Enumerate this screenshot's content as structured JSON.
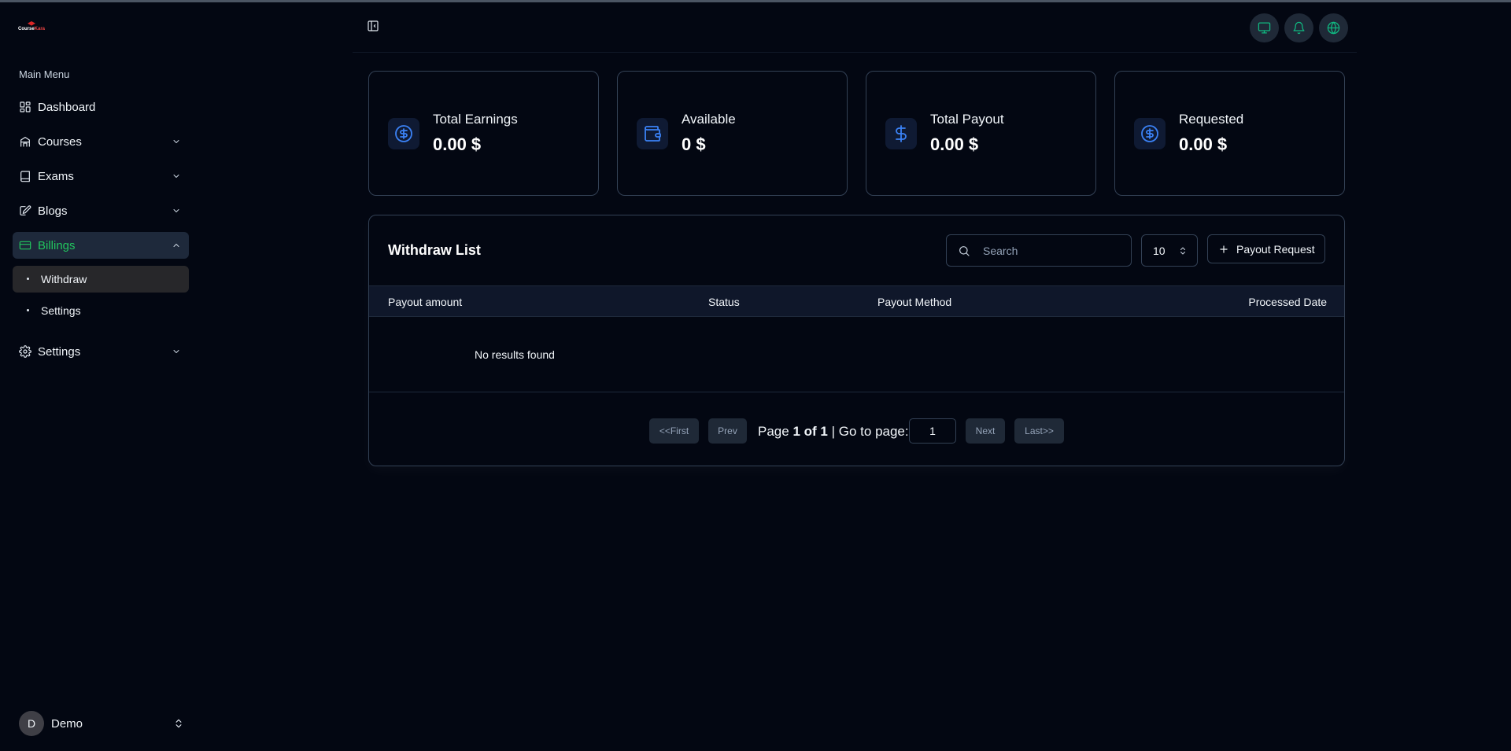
{
  "sidebar": {
    "logo": {
      "brand": "Course",
      "brand_accent": "Kara"
    },
    "menu_title": "Main Menu",
    "items": [
      {
        "label": "Dashboard",
        "icon": "dashboard-icon"
      },
      {
        "label": "Courses",
        "icon": "courses-icon"
      },
      {
        "label": "Exams",
        "icon": "exams-icon"
      },
      {
        "label": "Blogs",
        "icon": "blogs-icon"
      },
      {
        "label": "Billings",
        "icon": "billing-card-icon"
      },
      {
        "label": "Settings",
        "icon": "gear-icon"
      }
    ],
    "billing_sub": [
      {
        "label": "Withdraw"
      },
      {
        "label": "Settings"
      }
    ],
    "user": {
      "initial": "D",
      "name": "Demo"
    }
  },
  "header": {
    "buttons": [
      "monitor-icon",
      "bell-icon",
      "globe-icon"
    ]
  },
  "stats": [
    {
      "label": "Total Earnings",
      "value": "0.00 $",
      "icon": "dollar-circle-icon"
    },
    {
      "label": "Available",
      "value": "0 $",
      "icon": "wallet-icon"
    },
    {
      "label": "Total Payout",
      "value": "0.00 $",
      "icon": "dollar-icon"
    },
    {
      "label": "Requested",
      "value": "0.00 $",
      "icon": "dollar-circle-icon"
    }
  ],
  "withdraw": {
    "title": "Withdraw List",
    "search_placeholder": "Search",
    "page_size": "10",
    "payout_button": "Payout Request",
    "columns": [
      "Payout amount",
      "Status",
      "Payout Method",
      "Processed Date"
    ],
    "empty_text": "No results found",
    "pagination": {
      "first": "<<First",
      "prev": "Prev",
      "page_word": "Page",
      "current": "1",
      "of_word": "of",
      "total": "1",
      "goto_label": "| Go to page:",
      "goto_value": "1",
      "next": "Next",
      "last": "Last>>"
    }
  },
  "colors": {
    "accent": "#22c55e",
    "icon_blue": "#3b82f6",
    "background": "#030712"
  }
}
